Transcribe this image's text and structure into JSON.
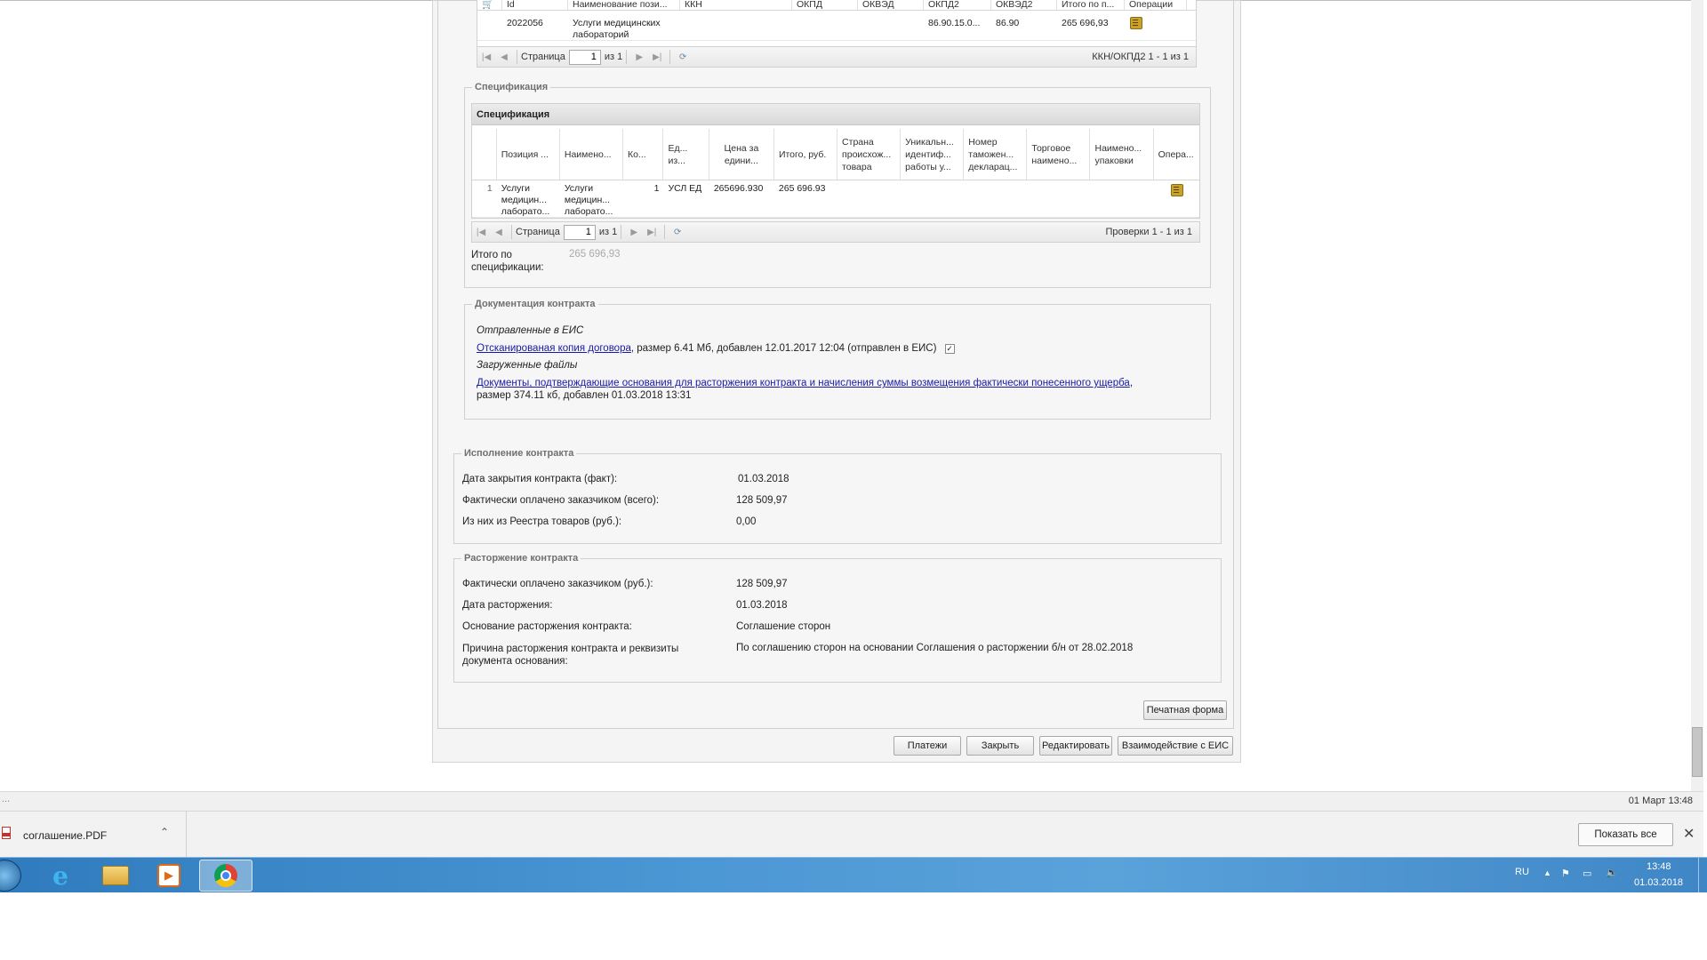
{
  "okpd_grid": {
    "headers": [
      "Id",
      "Наименование пози...",
      "ККН",
      "ОКПД",
      "ОКВЭД",
      "ОКПД2",
      "ОКВЭД2",
      "Итого по п...",
      "Операции"
    ],
    "row": {
      "id": "2022056",
      "name": "Услуги медицинских лабораторий",
      "okpd2": "86.90.15.0...",
      "okved2": "86.90",
      "total": "265 696,93"
    },
    "pager": {
      "page_label": "Страница",
      "page_value": "1",
      "of_label": "из 1",
      "summary": "ККН/ОКПД2 1 - 1 из 1"
    }
  },
  "spec": {
    "legend": "Спецификация",
    "grid_title": "Спецификация",
    "headers": [
      "Позиция ...",
      "Наимено...",
      "Ко...",
      "Ед... из...",
      "Цена за едини...",
      "Итого, руб.",
      "Страна происхож... товара",
      "Уникальн... идентиф... работы у...",
      "Номер таможен... декларац...",
      "Торговое наимено...",
      "Наимено... упаковки",
      "Опера..."
    ],
    "row": {
      "num": "1",
      "position": "Услуги медицин... лаборато...",
      "name": "Услуги медицин... лаборато...",
      "qty": "1",
      "unit": "УСЛ ЕД",
      "price": "265696.930",
      "total": "265 696.93"
    },
    "pager": {
      "page_label": "Страница",
      "page_value": "1",
      "of_label": "из 1",
      "summary": "Проверки 1 - 1 из 1"
    },
    "total_label": "Итого по спецификации:",
    "total_value": "265 696,93"
  },
  "docs": {
    "legend": "Документация контракта",
    "sent_heading": "Отправленные в ЕИС",
    "sent_link": "Отсканированая копия договора",
    "sent_meta": ", размер 6.41 Мб, добавлен 12.01.2017 12:04 (отправлен в ЕИС)",
    "uploaded_heading": "Загруженные файлы",
    "uploaded_link": "Документы, подтверждающие основания для расторжения контракта и начисления суммы возмещения фактически понесенного ущерба",
    "uploaded_sep": ",",
    "uploaded_meta": "размер 374.11 кб, добавлен 01.03.2018 13:31"
  },
  "execution": {
    "legend": "Исполнение контракта",
    "rows": [
      {
        "label": "Дата закрытия контракта (факт):",
        "value": "01.03.2018"
      },
      {
        "label": "Фактически оплачено заказчиком (всего):",
        "value": "128 509,97"
      },
      {
        "label": "Из них из Реестра товаров (руб.):",
        "value": "0,00"
      }
    ]
  },
  "termination": {
    "legend": "Расторжение контракта",
    "rows": [
      {
        "label": "Фактически оплачено заказчиком (руб.):",
        "value": "128 509,97"
      },
      {
        "label": "Дата расторжения:",
        "value": "01.03.2018"
      },
      {
        "label": "Основание расторжения контракта:",
        "value": "Соглашение сторон"
      },
      {
        "label": "Причина расторжения контракта и реквизиты документа основания:",
        "value": "По соглашению сторон на основании Соглашения о расторжении б/н от 28.02.2018"
      }
    ]
  },
  "buttons": {
    "print": "Печатная форма",
    "payments": "Платежи",
    "close": "Закрыть",
    "edit": "Редактировать",
    "eis": "Взаимодействие с ЕИС"
  },
  "status_bar": {
    "left": "...",
    "datetime": "01 Март 13:48"
  },
  "downloads_bar": {
    "file": "соглашение.PDF",
    "show_all": "Показать все"
  },
  "taskbar": {
    "lang": "RU",
    "time": "13:48",
    "date": "01.03.2018"
  },
  "colors": {
    "link": "#1a1aa6",
    "taskbar": "#4b97d4"
  }
}
